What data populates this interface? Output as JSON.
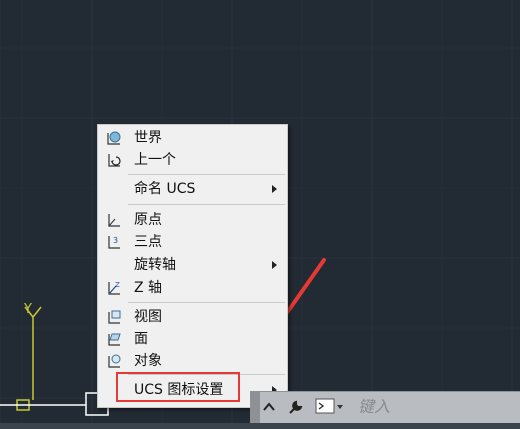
{
  "menu": {
    "items": [
      {
        "label": "世界",
        "icon": "ucs-world-icon"
      },
      {
        "label": "上一个",
        "icon": "ucs-previous-icon"
      },
      {
        "label": "命名 UCS",
        "submenu": true
      },
      {
        "label": "原点",
        "icon": "ucs-origin-icon"
      },
      {
        "label": "三点",
        "icon": "ucs-3point-icon"
      },
      {
        "label": "旋转轴",
        "submenu": true
      },
      {
        "label": "Z 轴",
        "icon": "ucs-zaxis-icon"
      },
      {
        "label": "视图",
        "icon": "ucs-view-icon"
      },
      {
        "label": "面",
        "icon": "ucs-face-icon"
      },
      {
        "label": "对象",
        "icon": "ucs-object-icon"
      },
      {
        "label": "UCS 图标设置",
        "submenu": true
      }
    ]
  },
  "ucs_axis": {
    "y_label": "Y"
  },
  "command": {
    "placeholder": "键入"
  },
  "colors": {
    "background": "#222a33",
    "axis": "#c8c832",
    "highlight": "#e53935",
    "arrow": "#e53935"
  }
}
